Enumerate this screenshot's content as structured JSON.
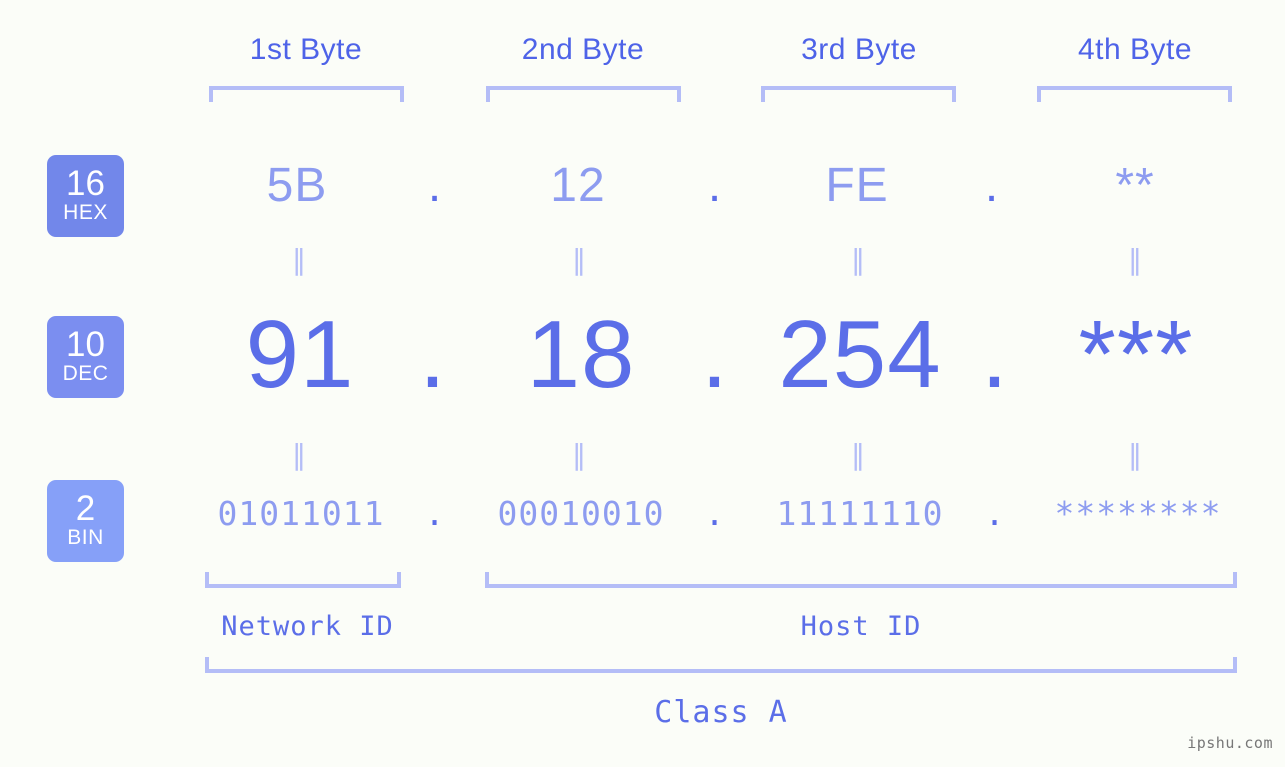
{
  "theme": {
    "background": "#fbfdf8",
    "accent_dark": "#5b6ee8",
    "accent_light": "#8d9cf0",
    "bracket": "#b4bdf7",
    "badge_hex": "#7287ea",
    "badge_dec": "#7b8ef0",
    "badge_bin": "#86a0f8",
    "watermark_color": "#777777"
  },
  "headers": [
    {
      "label": "1st Byte"
    },
    {
      "label": "2nd Byte"
    },
    {
      "label": "3rd Byte"
    },
    {
      "label": "4th Byte"
    }
  ],
  "bases": [
    {
      "number": "16",
      "name": "HEX"
    },
    {
      "number": "10",
      "name": "DEC"
    },
    {
      "number": "2",
      "name": "BIN"
    }
  ],
  "rows": {
    "hex": {
      "values": [
        "5B",
        "12",
        "FE",
        "**"
      ],
      "separator": "."
    },
    "dec": {
      "values": [
        "91",
        "18",
        "254",
        "***"
      ],
      "separator": "."
    },
    "bin": {
      "values": [
        "01011011",
        "00010010",
        "11111110",
        "********"
      ],
      "separator": "."
    }
  },
  "equals_symbol": "‖",
  "captions": {
    "network_id": "Network ID",
    "host_id": "Host ID",
    "class": "Class A"
  },
  "watermark": "ipshu.com"
}
